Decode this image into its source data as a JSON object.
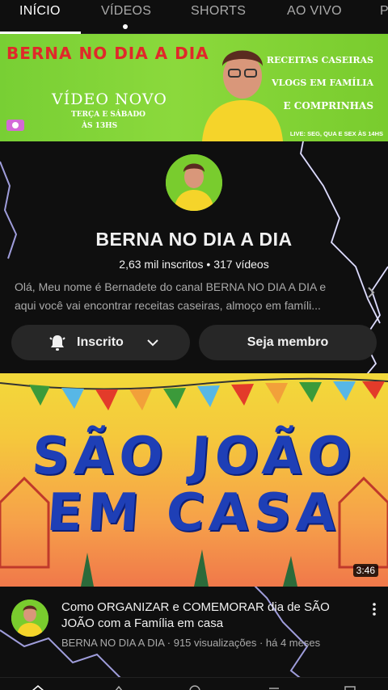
{
  "tabs": [
    {
      "label": "INÍCIO",
      "active": true
    },
    {
      "label": "VÍDEOS",
      "active": false
    },
    {
      "label": "SHORTS",
      "active": false
    },
    {
      "label": "AO VIVO",
      "active": false
    },
    {
      "label": "P",
      "active": false
    }
  ],
  "banner": {
    "title": "BERNA NO DIA A DIA",
    "video_novo": "VÍDEO NOVO",
    "days": "TERÇA E SÁBADO",
    "hour": "ÀS 13HS",
    "right_line1": "RECEITAS CASEIRAS",
    "right_line2": "VLOGS EM FAMÍLIA",
    "right_line3": "E COMPRINHAS",
    "live": "LIVE: SEG, QUA E SEX ÀS 14HS"
  },
  "channel": {
    "name": "BERNA NO DIA A DIA",
    "stats": "2,63 mil inscritos • 317 vídeos",
    "description_line1": "Olá, Meu nome é Bernadete do canal BERNA NO DIA A DIA e",
    "description_line2": "aqui você vai encontrar receitas caseiras, almoço em famíli..."
  },
  "buttons": {
    "subscribed_label": "Inscrito",
    "member_label": "Seja membro"
  },
  "video": {
    "thumb_line1": "SÃO JOÃO",
    "thumb_line2": "EM CASA",
    "duration": "3:46",
    "title": "Como ORGANIZAR e COMEMORAR dia de SÃO JOÃO com a Família em casa",
    "meta": "BERNA NO DIA A DIA · 915 visualizações · há 4 meses"
  },
  "colors": {
    "background": "#0f0f0f",
    "banner_green": "#79cc2e",
    "banner_red_text": "#e0282a",
    "thumb_blue_text": "#1e3fb6",
    "button_bg": "#272727"
  },
  "icons": [
    "bell-icon",
    "chevron-down-icon",
    "chevron-right-icon",
    "more-vert-icon",
    "lightning-decoration"
  ]
}
